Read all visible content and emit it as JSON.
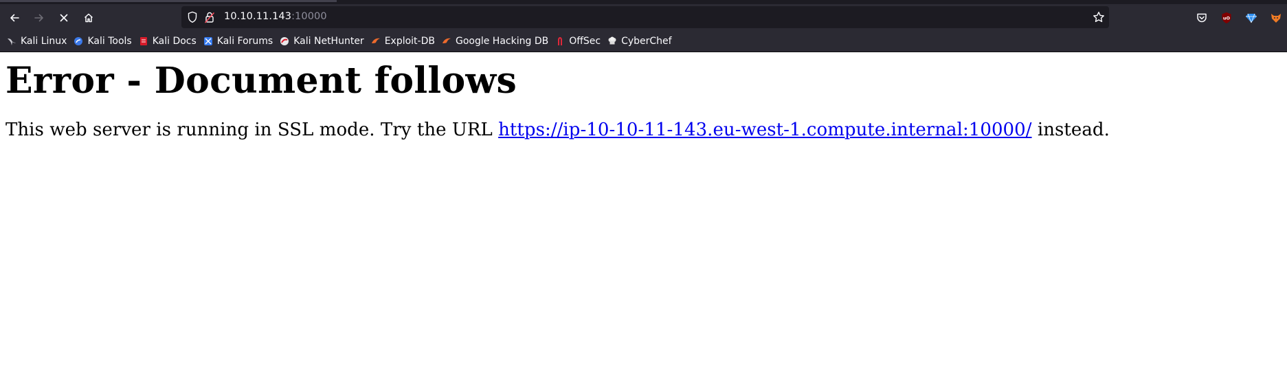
{
  "browser": {
    "url_host": "10.10.11.143",
    "url_port": ":10000",
    "toolbar_icons": [
      "back-arrow-icon",
      "forward-arrow-icon",
      "stop-loading-icon",
      "home-icon",
      "shield-icon",
      "lock-icon",
      "star-icon",
      "pocket-icon",
      "ublock-icon",
      "extension-gem-icon",
      "foxyproxy-icon"
    ]
  },
  "bookmarks": [
    {
      "label": "Kali Linux",
      "icon": "kali-dragon-icon"
    },
    {
      "label": "Kali Tools",
      "icon": "kali-tools-icon"
    },
    {
      "label": "Kali Docs",
      "icon": "kali-docs-icon"
    },
    {
      "label": "Kali Forums",
      "icon": "kali-forums-icon"
    },
    {
      "label": "Kali NetHunter",
      "icon": "nethunter-icon"
    },
    {
      "label": "Exploit-DB",
      "icon": "exploitdb-icon"
    },
    {
      "label": "Google Hacking DB",
      "icon": "ghdb-icon"
    },
    {
      "label": "OffSec",
      "icon": "offsec-icon"
    },
    {
      "label": "CyberChef",
      "icon": "cyberchef-icon"
    }
  ],
  "page": {
    "heading": "Error - Document follows",
    "text_before": "This web server is running in SSL mode. Try the URL ",
    "link": "https://ip-10-10-11-143.eu-west-1.compute.internal:10000/",
    "text_after": " instead."
  },
  "colors": {
    "chrome": "#2b2a33",
    "urlbar": "#1c1b22",
    "link": "#0000ee"
  }
}
